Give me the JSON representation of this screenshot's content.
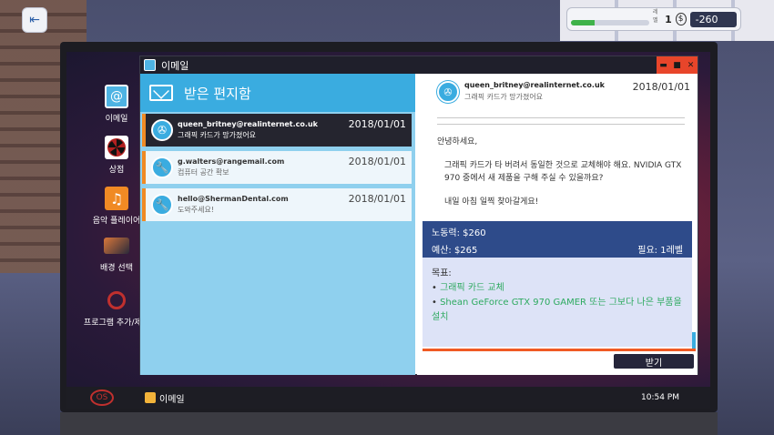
{
  "hud": {
    "level_label": "레벨",
    "level": "1",
    "coin_symbol": "$",
    "money": "-260",
    "xp_progress": 0.3
  },
  "desktop": {
    "icons": [
      {
        "label": "이메일"
      },
      {
        "label": "상점"
      },
      {
        "label": "음악 플레이어"
      },
      {
        "label": "배경 선택"
      },
      {
        "label": "프로그램 추가/제거"
      }
    ]
  },
  "taskbar": {
    "start_label": "OS",
    "app_label": "이메일",
    "clock": "10:54 PM"
  },
  "window": {
    "title": "이메일",
    "controls": {
      "minimize": "▬",
      "maximize": "■",
      "close": "✕"
    }
  },
  "inbox": {
    "title": "받은 편지함",
    "mails": [
      {
        "from": "queen_britney@realinternet.co.uk",
        "subject": "그래픽 카드가 망가졌어요",
        "date": "2018/01/01"
      },
      {
        "from": "g.walters@rangemail.com",
        "subject": "컴퓨터 공간 확보",
        "date": "2018/01/01"
      },
      {
        "from": "hello@ShermanDental.com",
        "subject": "도와주세요!",
        "date": "2018/01/01"
      }
    ]
  },
  "message": {
    "from": "queen_britney@realinternet.co.uk",
    "subject": "그래픽 카드가 망가졌어요",
    "date": "2018/01/01",
    "greeting": "안녕하세요,",
    "body": "그래픽 카드가 타 버려서 동일한 것으로 교체해야 해요. NVIDIA GTX 970 중에서 새 제품을 구해 주실 수 있을까요?",
    "closing": "내일 아침 일찍 찾아갈게요!",
    "labor": "노동력: $260",
    "budget": "예산: $265",
    "required": "필요: 1레벨",
    "goals_title": "목표:",
    "goals": [
      "그래픽 카드 교체",
      "Shean GeForce GTX 970 GAMER 또는 그보다 나은 부품을 설치"
    ],
    "accept_label": "받기"
  }
}
